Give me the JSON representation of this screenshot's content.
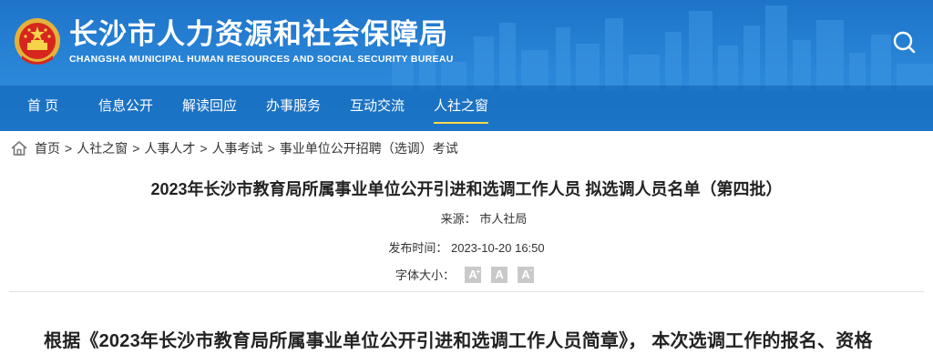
{
  "site": {
    "title_cn": "长沙市人力资源和社会保障局",
    "title_en": "CHANGSHA MUNICIPAL HUMAN RESOURCES AND SOCIAL SECURITY BUREAU",
    "emblem_icon": "national-emblem-icon",
    "search_icon": "search-icon"
  },
  "nav": {
    "items": [
      {
        "label": "首 页"
      },
      {
        "label": "信息公开"
      },
      {
        "label": "解读回应"
      },
      {
        "label": "办事服务"
      },
      {
        "label": "互动交流"
      },
      {
        "label": "人社之窗",
        "active": true
      }
    ]
  },
  "breadcrumb": {
    "home_icon": "home-icon",
    "items": [
      "首页",
      "人社之窗",
      "人事人才",
      "人事考试",
      "事业单位公开招聘（选调）考试"
    ],
    "separator": ">"
  },
  "article": {
    "title": "2023年长沙市教育局所属事业单位公开引进和选调工作人员 拟选调人员名单（第四批）",
    "source_label": "来源：",
    "source_value": "市人社局",
    "time_label": "发布时间：",
    "time_value": "2023-10-20 16:50",
    "font_size_label": "字体大小：",
    "font_buttons": [
      "A",
      "A",
      "A"
    ],
    "body_first_line": "根据《2023年长沙市教育局所属事业单位公开引进和选调工作人员简章》， 本次选调工作的报名、资格"
  },
  "colors": {
    "header_blue": "#2a86d8",
    "nav_active_underline": "#ffd84a",
    "text": "#222222"
  }
}
